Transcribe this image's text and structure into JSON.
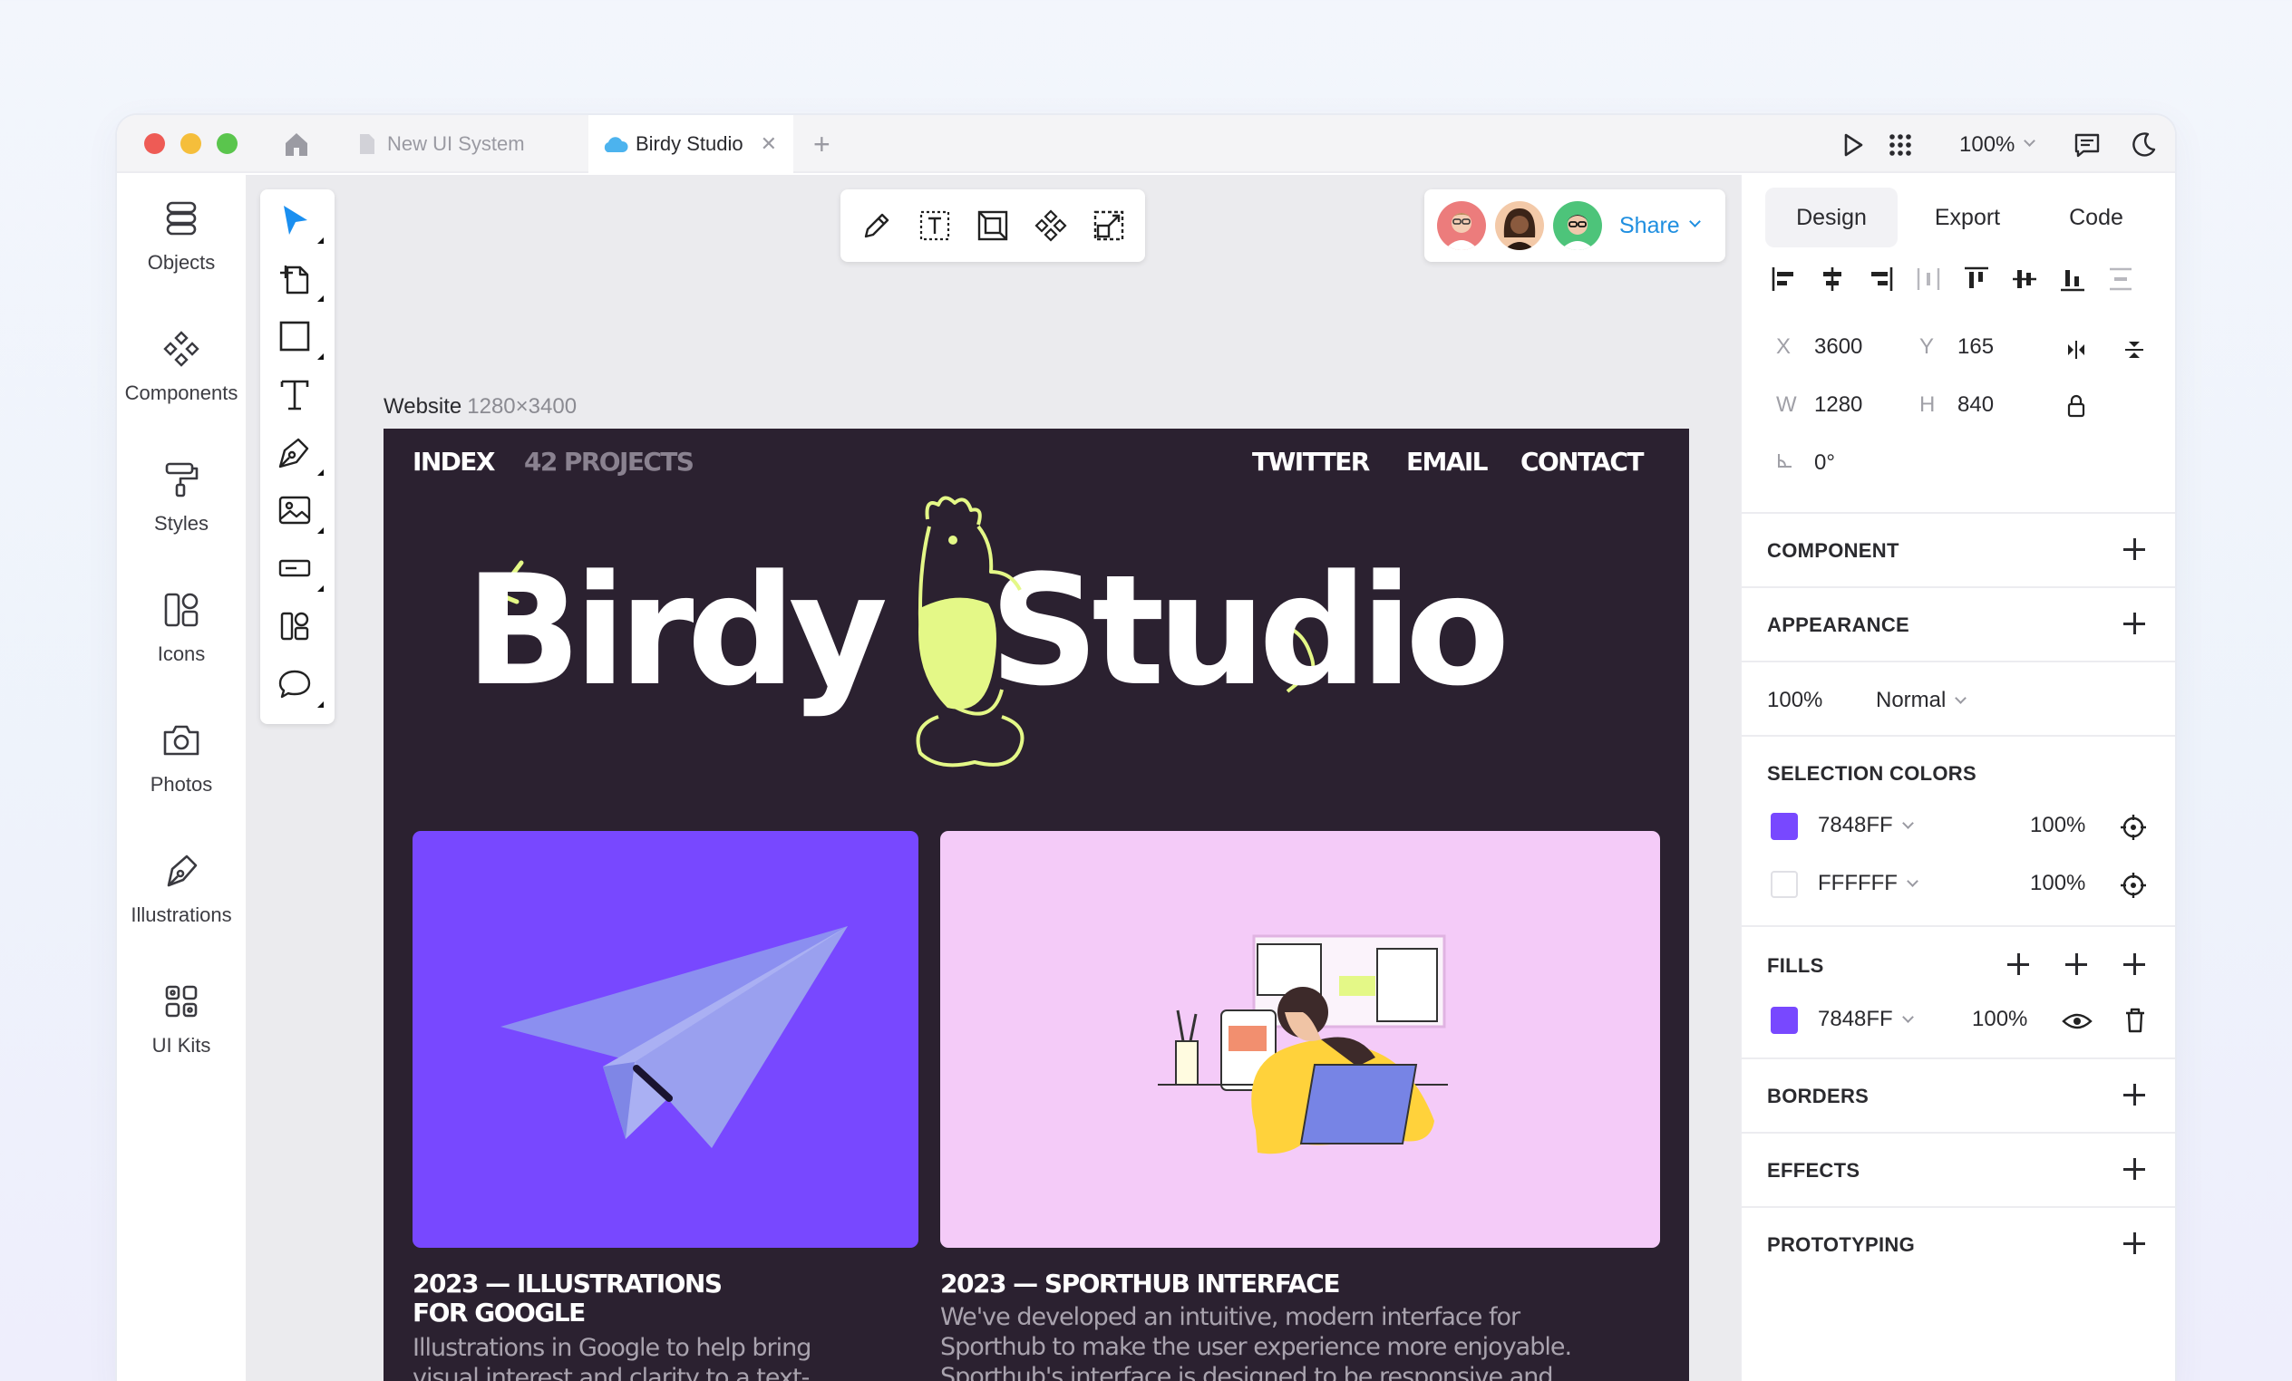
{
  "tabs": [
    {
      "label": "New UI System"
    },
    {
      "label": "Birdy Studio"
    }
  ],
  "zoom": "100%",
  "sidebar": {
    "items": [
      {
        "label": "Objects",
        "icon": "stack-icon"
      },
      {
        "label": "Components",
        "icon": "components-icon"
      },
      {
        "label": "Styles",
        "icon": "paint-roller-icon"
      },
      {
        "label": "Icons",
        "icon": "icons-icon"
      },
      {
        "label": "Photos",
        "icon": "camera-icon"
      },
      {
        "label": "Illustrations",
        "icon": "pen-nib-icon"
      },
      {
        "label": "UI Kits",
        "icon": "grid-icon"
      }
    ]
  },
  "share_label": "Share",
  "frame": {
    "name": "Website",
    "size": "1280×3400"
  },
  "site": {
    "nav_left": [
      "INDEX",
      "42 PROJECTS"
    ],
    "nav_right": [
      "TWITTER",
      "EMAIL",
      "CONTACT"
    ],
    "brand_left": "Birdy",
    "brand_right": "Studio",
    "projects": [
      {
        "title": "2023 — ILLUSTRATIONS\nFOR GOOGLE",
        "desc": "Illustrations in Google to help bring\nvisual interest and clarity to a text-"
      },
      {
        "title": "2023 — SPORTHUB INTERFACE",
        "desc": "We've developed an intuitive, modern interface for\nSporthub to make the user experience more enjoyable.\nSporthub's interface is designed to be responsive and"
      }
    ]
  },
  "panel": {
    "tabs": [
      "Design",
      "Export",
      "Code"
    ],
    "x_label": "X",
    "x": "3600",
    "y_label": "Y",
    "y": "165",
    "w_label": "W",
    "w": "1280",
    "h_label": "H",
    "h": "840",
    "rotation": "0°",
    "sections": {
      "component": "COMPONENT",
      "appearance": "APPEARANCE",
      "selection_colors": "SELECTION COLORS",
      "fills": "FILLS",
      "borders": "BORDERS",
      "effects": "EFFECTS",
      "prototyping": "PROTOTYPING"
    },
    "opacity": "100%",
    "blend": "Normal",
    "selection_colors": [
      {
        "hex": "7848FF",
        "opacity": "100%",
        "color": "#7848FF"
      },
      {
        "hex": "FFFFFF",
        "opacity": "100%",
        "color": "#FFFFFF"
      }
    ],
    "fill": {
      "hex": "7848FF",
      "opacity": "100%",
      "color": "#7848FF"
    }
  }
}
